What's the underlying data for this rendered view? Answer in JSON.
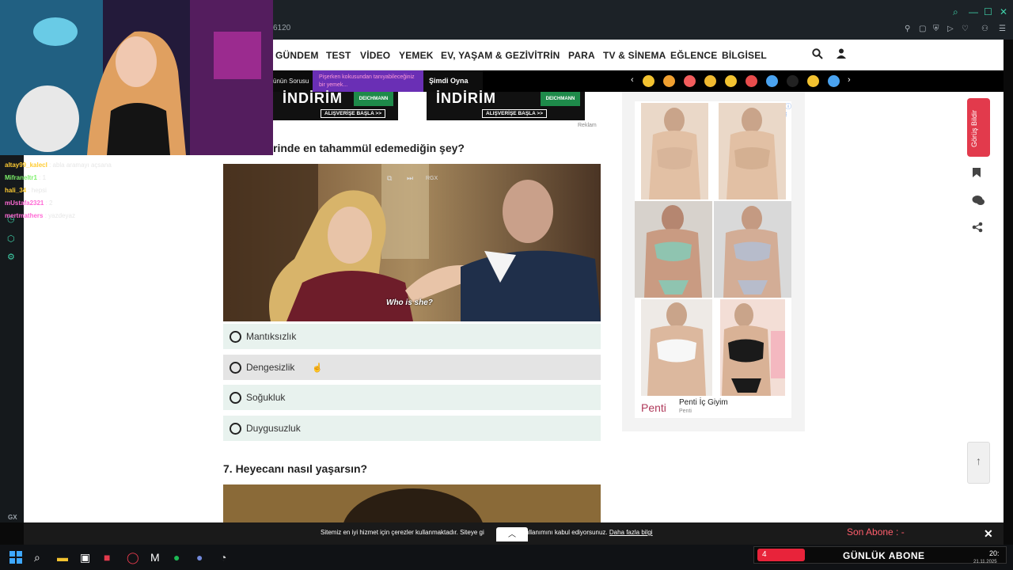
{
  "browser": {
    "address_fragment": "6120"
  },
  "nav": {
    "items": [
      "GÜNDEM",
      "TEST",
      "VİDEO",
      "YEMEK",
      "EV, YAŞAM & GEZİ",
      "VİTRİN",
      "PARA",
      "TV & SİNEMA",
      "EĞLENCE",
      "BİLGİSEL"
    ]
  },
  "emoji_bar": {
    "promo_left": "ünün Sorusu",
    "promo_mid": "Pişerken kokusundan tanıyabileceğiniz bir yemek...",
    "promo_right": "Şimdi Oyna",
    "emoji_colors": [
      "#f2c230",
      "#f0a030",
      "#f25c5c",
      "#f0b930",
      "#f2c230",
      "#e84c4c",
      "#4aa3f0",
      "#222222",
      "#f2c230",
      "#4aa3f0"
    ]
  },
  "ad_banner": {
    "left_title": "İNDİRİM",
    "right_title": "İNDİRİM",
    "brand": "DEICHMANN",
    "cta": "ALIŞVERİŞE BAŞLA >>",
    "reklam": "Reklam"
  },
  "question6": {
    "title": "rinde en tahammül edemediğin şey?",
    "gif_caption": "Who is she?",
    "gif_badge": "RGX",
    "options": [
      "Mantıksızlık",
      "Dengesizlik",
      "Soğukluk",
      "Duygusuzluk"
    ],
    "hovered_option": "Dengesizlik"
  },
  "question7": {
    "title": "7. Heyecanı nasıl yaşarsın?"
  },
  "right_ad": {
    "brand_logo": "Penti",
    "brand_name": "Penti İç Giyim",
    "brand_sub": "Penti",
    "info": "ⓘ ⁝"
  },
  "right_rail": {
    "feedback": "Görüş Bildir",
    "icons": [
      "bookmark-icon",
      "comments-icon",
      "share-icon",
      "arrow-up-icon"
    ]
  },
  "cookie": {
    "text": "Sitemiz en iyi hizmet için çerezler kullanmaktadır. Siteye gi",
    "text2": "çerez kullanımını kabul ediyorsunuz.",
    "link": "Daha fazla bilgi"
  },
  "stream_overlay": {
    "son_abone": "Son Abone : -",
    "gunluk_count": "4",
    "gunluk_label": "GÜNLÜK ABONE"
  },
  "chat": [
    {
      "user": "altay99_kalecI",
      "msg": ": abla aramayı açsana"
    },
    {
      "user": "Mifraneltr1",
      "msg": ": 1"
    },
    {
      "user": "hali_34",
      "msg": ": hepsi"
    },
    {
      "user": "mUstafa2321",
      "msg": ": 2"
    },
    {
      "user": "mertmathers",
      "msg": ": yazdeyaz"
    }
  ],
  "taskbar": {
    "time": "20:",
    "date": "21.11.2025"
  }
}
